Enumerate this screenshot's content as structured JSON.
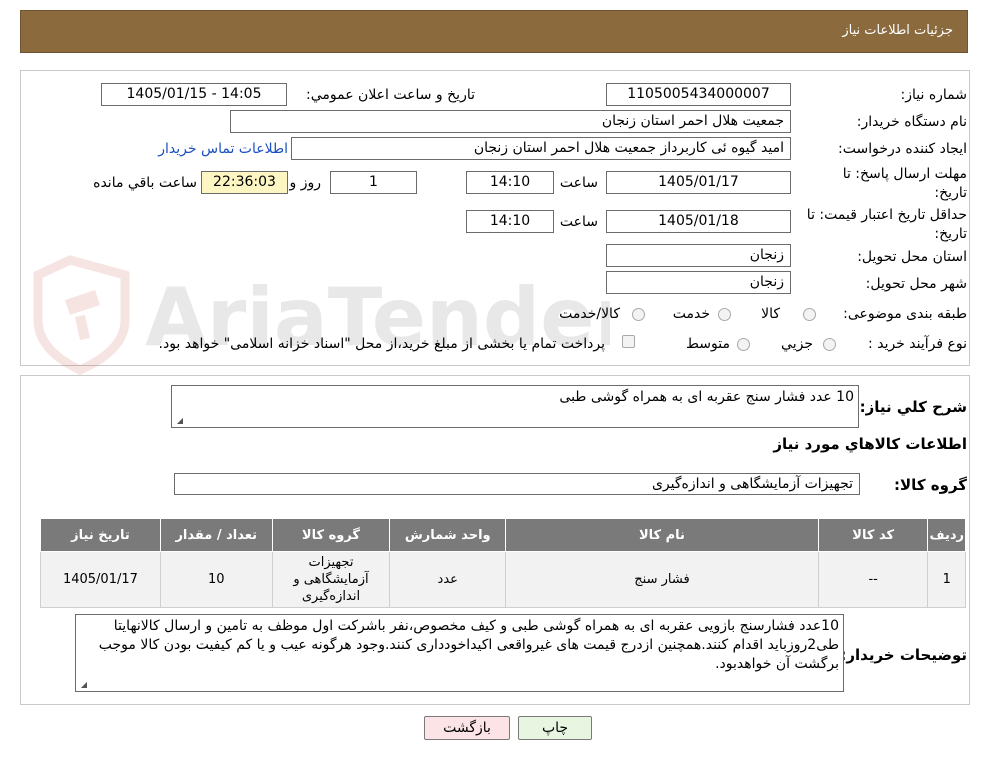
{
  "header": {
    "title": "جزئیات اطلاعات نیاز"
  },
  "fields": {
    "need_number_label": "شماره نیاز:",
    "need_number": "1105005434000007",
    "announce_label": "تاریخ و ساعت اعلان عمومي:",
    "announce_value": "1405/01/15 - 14:05",
    "buyer_org_label": "نام دستگاه خريدار:",
    "buyer_org": "جمعیت هلال احمر استان زنجان",
    "creator_label": "ایجاد کننده درخواست:",
    "creator": "امید گیوه ئی کاربرداز  جمعیت هلال احمر استان زنجان",
    "contact_link": "اطلاعات تماس خریدار",
    "deadline_label": "مهلت ارسال پاسخ: تا تاریخ:",
    "deadline_date": "1405/01/17",
    "time_label": "ساعت",
    "deadline_time": "14:10",
    "days_value": "1",
    "days_label": "روز و",
    "remaining_time": "22:36:03",
    "remaining_label": "ساعت باقي مانده",
    "validity_label": "حداقل تاریخ اعتبار قیمت: تا تاریخ:",
    "validity_date": "1405/01/18",
    "validity_time": "14:10",
    "province_label": "استان محل تحویل:",
    "province": "زنجان",
    "city_label": "شهر محل تحویل:",
    "city": "زنجان",
    "category_label": "طبقه بندی موضوعی:",
    "category_options": [
      "کالا",
      "خدمت",
      "کالا/خدمت"
    ],
    "process_label": "نوع فرآیند خرید :",
    "process_options": [
      "جزیي",
      "متوسط"
    ],
    "payment_note": "پرداخت تمام یا بخشی از مبلغ خرید،از محل \"اسناد خزانه اسلامی\" خواهد بود."
  },
  "description": {
    "label": "شرح کلي نياز:",
    "value": "10 عدد فشار سنج عقربه ای به همراه گوشی طبی"
  },
  "goods_section": {
    "title": "اطلاعات کالاهاي مورد نياز",
    "group_label": "گروه کالا:",
    "group_value": "تجهیزات آزمایشگاهی و اندازه‌گیری"
  },
  "table": {
    "headers": [
      "رديف",
      "کد کالا",
      "نام کالا",
      "واحد شمارش",
      "گروه کالا",
      "تعداد / مقدار",
      "تاريخ نياز"
    ],
    "rows": [
      [
        "1",
        "--",
        "فشار سنج",
        "عدد",
        "تجهیزات آزمایشگاهی و اندازه‌گیری",
        "10",
        "1405/01/17"
      ]
    ]
  },
  "buyer_notes": {
    "label": "توضیحات خریدار:",
    "value": "10عدد فشارسنج بازویی عقربه ای به همراه گوشی طبی و کیف مخصوص،نفر باشرکت اول موظف به تامین و ارسال کالانهایتا طی2روزباید اقدام کنند.همچنین ازدرج قیمت های غیرواقعی اکیداخودداری کنند.وجود هرگونه عیب و یا کم کیفیت بودن کالا موجب برگشت آن خواهدبود."
  },
  "buttons": {
    "print": "چاپ",
    "back": "بازگشت"
  },
  "watermark_text": "AriaTender.neT",
  "colors": {
    "header": "#8b6b3d",
    "table_header": "#7a7a7a",
    "contact_link": "#1a4fbf",
    "back_button": "#fbe3e6",
    "print_button": "#e7f5e1"
  }
}
